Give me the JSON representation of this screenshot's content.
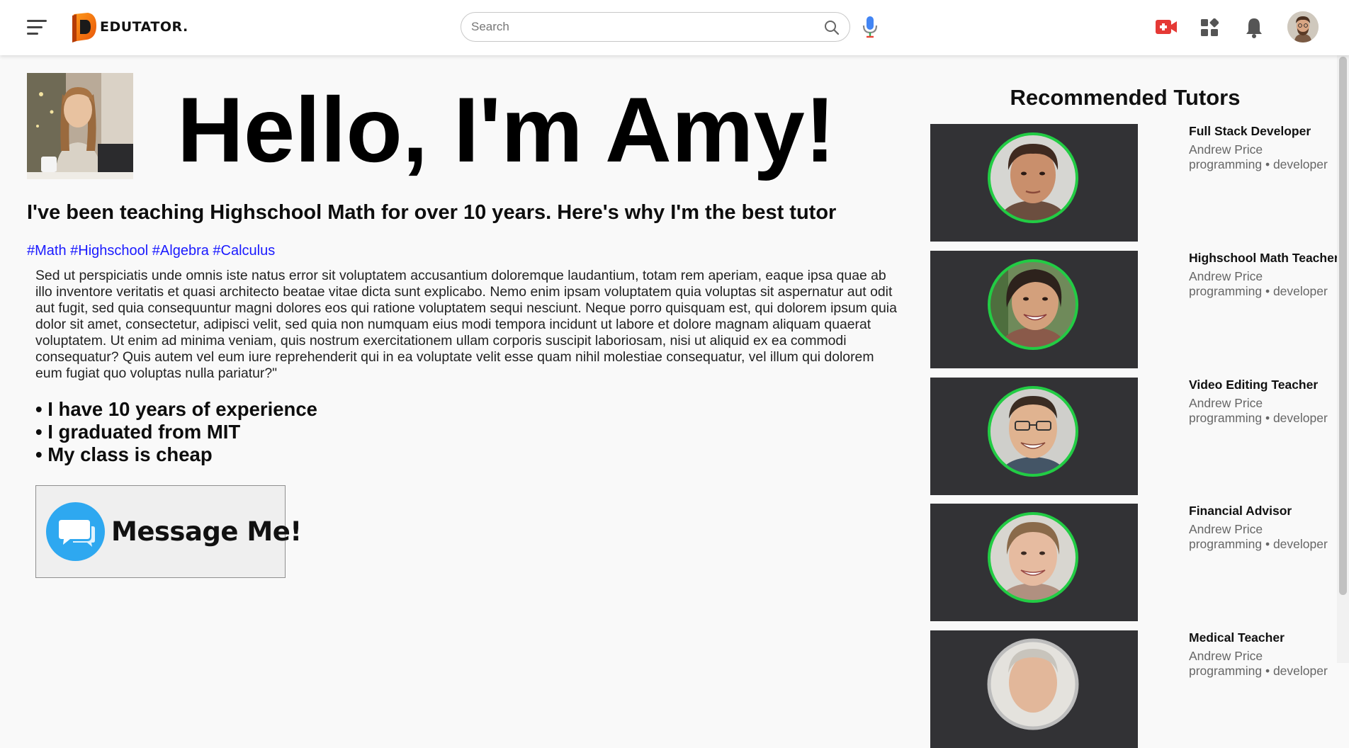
{
  "header": {
    "logo_text": "EDUTATOR.",
    "search_placeholder": "Search"
  },
  "profile": {
    "greeting": "Hello, I'm Amy!",
    "subtitle": "I've been teaching Highschool Math for over 10 years. Here's why I'm the best tutor",
    "tags": [
      "#Math",
      "#Highschool",
      "#Algebra",
      "#Calculus"
    ],
    "bio": "Sed ut perspiciatis unde omnis iste natus error sit voluptatem accusantium doloremque laudantium, totam rem aperiam, eaque ipsa quae ab illo inventore veritatis et quasi architecto beatae vitae dicta sunt explicabo. Nemo enim ipsam voluptatem quia voluptas sit aspernatur aut odit aut fugit, sed quia consequuntur magni dolores eos qui ratione voluptatem sequi nesciunt. Neque porro quisquam est, qui dolorem ipsum quia dolor sit amet, consectetur, adipisci velit, sed quia non numquam eius modi tempora incidunt ut labore et dolore magnam aliquam quaerat voluptatem. Ut enim ad minima veniam, quis nostrum exercitationem ullam corporis suscipit laboriosam, nisi ut aliquid ex ea commodi consequatur? Quis autem vel eum iure reprehenderit qui in ea voluptate velit esse quam nihil molestiae consequatur, vel illum qui dolorem eum fugiat quo voluptas nulla pariatur?\"",
    "bullets": [
      "• I have 10 years of experience",
      "• I graduated from MIT",
      "• My class is cheap"
    ],
    "message_button_label": "Message Me!"
  },
  "recommended": {
    "title": "Recommended Tutors",
    "tutors": [
      {
        "role": "Full Stack Developer",
        "name": "Andrew Price",
        "meta": "programming • developer"
      },
      {
        "role": "Highschool Math Teacher",
        "name": "Andrew Price",
        "meta": "programming • developer"
      },
      {
        "role": "Video Editing Teacher",
        "name": "Andrew Price",
        "meta": "programming • developer"
      },
      {
        "role": "Financial Advisor",
        "name": "Andrew Price",
        "meta": "programming • developer"
      },
      {
        "role": "Medical Teacher",
        "name": "Andrew Price",
        "meta": "programming • developer"
      }
    ]
  },
  "colors": {
    "accent_ring": "#22cc44",
    "tag_link": "#1a1aff",
    "record_icon": "#e53935",
    "message_icon_bg": "#2ea8f0"
  },
  "icons": [
    "menu-icon",
    "search-icon",
    "microphone-icon",
    "video-camera-icon",
    "apps-icon",
    "bell-icon",
    "chat-bubble-icon"
  ]
}
